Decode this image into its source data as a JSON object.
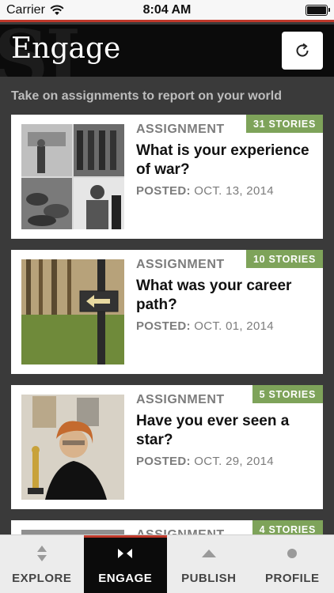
{
  "status_bar": {
    "carrier": "Carrier",
    "time": "8:04 AM"
  },
  "header": {
    "title": "Engage",
    "watermark": "SI"
  },
  "subtitle": "Take on assignments to report on your world",
  "cards": [
    {
      "label": "ASSIGNMENT",
      "badge": "31 STORIES",
      "title": "What is your experience of war?",
      "posted_label": "POSTED:",
      "posted_date": "OCT. 13, 2014"
    },
    {
      "label": "ASSIGNMENT",
      "badge": "10 STORIES",
      "title": "What was your career path?",
      "posted_label": "POSTED:",
      "posted_date": "OCT. 01, 2014"
    },
    {
      "label": "ASSIGNMENT",
      "badge": "5 STORIES",
      "title": "Have you ever seen a star?",
      "posted_label": "POSTED:",
      "posted_date": "OCT. 29, 2014"
    },
    {
      "label": "ASSIGNMENT",
      "badge": "4 STORIES"
    }
  ],
  "tabs": [
    {
      "label": "EXPLORE",
      "icon": "explore-icon",
      "active": false
    },
    {
      "label": "ENGAGE",
      "icon": "engage-icon",
      "active": true
    },
    {
      "label": "PUBLISH",
      "icon": "publish-icon",
      "active": false
    },
    {
      "label": "PROFILE",
      "icon": "profile-icon",
      "active": false
    }
  ],
  "colors": {
    "accent_red": "#c0392b",
    "badge_green": "#7ea35a",
    "header_bg": "#0b0b0b",
    "page_bg": "#3a3a3a"
  }
}
